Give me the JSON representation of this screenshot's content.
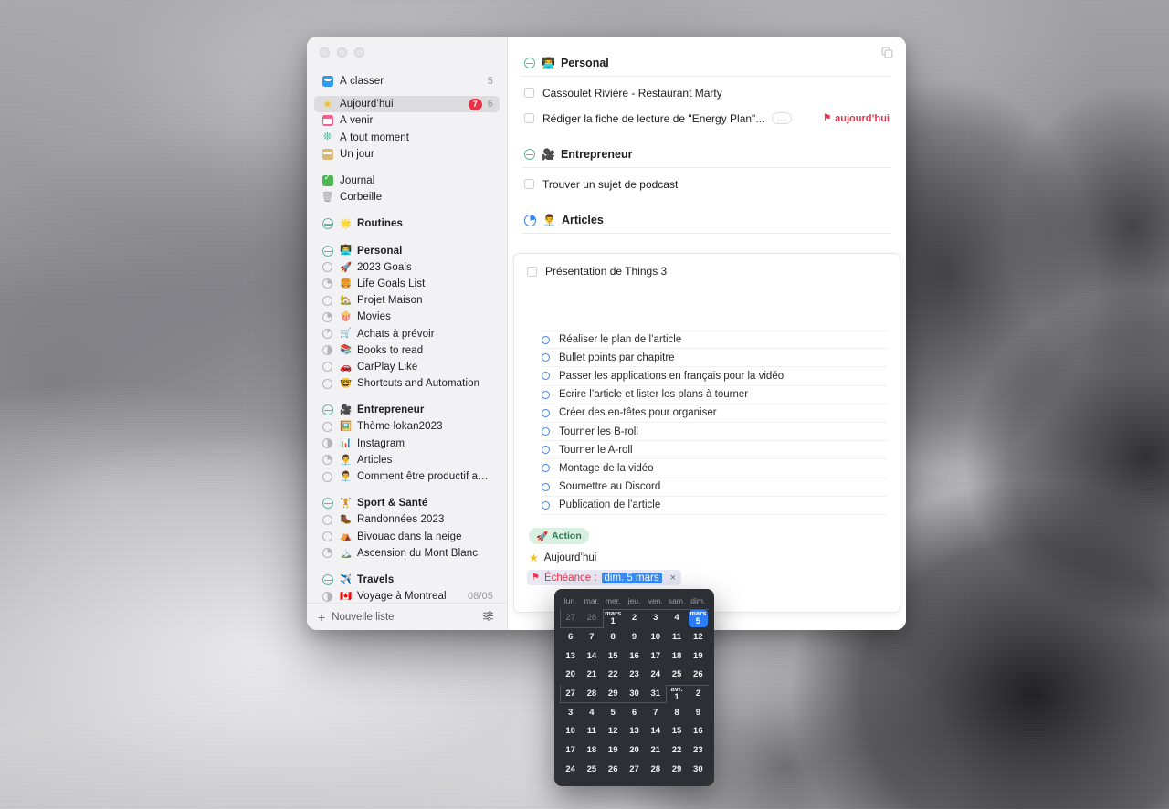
{
  "window": {
    "traffic_lights": [
      "close",
      "minimize",
      "zoom"
    ],
    "duplicate_icon": "duplicate-icon"
  },
  "sidebar": {
    "smart_lists": [
      {
        "icon": "inbox-icon",
        "label": "À classer",
        "count": "5"
      },
      {
        "icon": "star-icon",
        "label": "Aujourd’hui",
        "badge": "7",
        "count": "6",
        "selected": true
      },
      {
        "icon": "calendar-icon",
        "label": "À venir"
      },
      {
        "icon": "layers-icon",
        "label": "À tout moment"
      },
      {
        "icon": "someday-icon",
        "label": "Un jour"
      }
    ],
    "utility_lists": [
      {
        "icon": "journal-icon",
        "label": "Journal"
      },
      {
        "icon": "trash-icon",
        "label": "Corbeille"
      }
    ],
    "areas": [
      {
        "emoji": "🌟",
        "label": "Routines",
        "projects": []
      },
      {
        "emoji": "👨‍💻",
        "label": "Personal",
        "projects": [
          {
            "progress": "p0",
            "emoji": "🚀",
            "label": "2023 Goals"
          },
          {
            "progress": "p25",
            "emoji": "🍔",
            "label": "Life Goals List"
          },
          {
            "progress": "p0",
            "emoji": "🏡",
            "label": "Projet Maison"
          },
          {
            "progress": "p25",
            "emoji": "🍿",
            "label": "Movies"
          },
          {
            "progress": "p12",
            "emoji": "🛒",
            "label": "Achats à prévoir"
          },
          {
            "progress": "p50",
            "emoji": "📚",
            "label": "Books to read"
          },
          {
            "progress": "p0",
            "emoji": "🚗",
            "label": "CarPlay Like"
          },
          {
            "progress": "p0",
            "emoji": "🤓",
            "label": "Shortcuts and Automation"
          }
        ]
      },
      {
        "emoji": "🎥",
        "label": "Entrepreneur",
        "projects": [
          {
            "progress": "p0",
            "emoji": "🖼️",
            "label": "Thème lokan2023"
          },
          {
            "progress": "p50",
            "emoji": "📊",
            "label": "Instagram"
          },
          {
            "progress": "p25",
            "emoji": "👨‍💼",
            "label": "Articles"
          },
          {
            "progress": "p0",
            "emoji": "👨‍💼",
            "label": "Comment être productif avec..."
          }
        ]
      },
      {
        "emoji": "🏋️",
        "label": "Sport & Santé",
        "projects": [
          {
            "progress": "p0",
            "emoji": "🥾",
            "label": "Randonnées 2023"
          },
          {
            "progress": "p0",
            "emoji": "⛺",
            "label": "Bivouac dans la neige"
          },
          {
            "progress": "p25",
            "emoji": "🏔️",
            "label": "Ascension du Mont Blanc"
          }
        ]
      },
      {
        "emoji": "✈️",
        "label": "Travels",
        "projects": [
          {
            "progress": "p50",
            "emoji": "🇨🇦",
            "label": "Voyage à Montreal",
            "date": "08/05"
          }
        ]
      }
    ],
    "footer": {
      "new_list_label": "Nouvelle liste",
      "plus_icon": "plus-icon",
      "settings_icon": "sliders-icon"
    }
  },
  "main": {
    "groups": [
      {
        "icon": "area-icon",
        "emoji": "👨‍💻",
        "title": "Personal",
        "todos": [
          {
            "label": "Cassoulet Rivière - Restaurant Marty"
          },
          {
            "label": "Rédiger la fiche de lecture de \"Energy Plan\"...",
            "notes": "...",
            "due": "aujourd’hui",
            "flag": "deadline-flag-icon"
          }
        ]
      },
      {
        "icon": "area-icon",
        "emoji": "🎥",
        "title": "Entrepreneur",
        "todos": [
          {
            "label": "Trouver un sujet de podcast"
          }
        ]
      },
      {
        "icon": "project-pie-icon",
        "emoji": "👨‍💼",
        "title": "Articles",
        "todos": []
      }
    ],
    "task_card": {
      "title": "Présentation de Things 3",
      "checklist": [
        "Réaliser le plan de l’article",
        "Bullet points par chapitre",
        "Passer les applications en français pour la vidéo",
        "Ecrire l’article et lister les plans à tourner",
        "Créer des en-têtes pour organiser",
        "Tourner les B-roll",
        "Tourner le A-roll",
        "Montage de la vidéo",
        "Soumettre au Discord",
        "Publication de l’article"
      ],
      "tag": {
        "emoji": "🚀",
        "label": "Action"
      },
      "when": {
        "icon": "star-icon",
        "label": "Aujourd’hui"
      },
      "deadline": {
        "flag_icon": "deadline-flag-icon",
        "label": "Échéance :",
        "value": "dim. 5 mars",
        "clear_icon": "×"
      }
    }
  },
  "calendar": {
    "weekday_headers": [
      "lun.",
      "mar.",
      "mer.",
      "jeu.",
      "ven.",
      "sam.",
      "dim."
    ],
    "selected": "mars 5",
    "weeks": [
      [
        {
          "d": "27",
          "dim": true
        },
        {
          "d": "28",
          "dim": true
        },
        {
          "d": "1",
          "month": "mars"
        },
        {
          "d": "2"
        },
        {
          "d": "3"
        },
        {
          "d": "4"
        },
        {
          "d": "5",
          "month": "mars",
          "selected": true
        }
      ],
      [
        {
          "d": "6"
        },
        {
          "d": "7"
        },
        {
          "d": "8"
        },
        {
          "d": "9"
        },
        {
          "d": "10"
        },
        {
          "d": "11"
        },
        {
          "d": "12"
        }
      ],
      [
        {
          "d": "13"
        },
        {
          "d": "14"
        },
        {
          "d": "15"
        },
        {
          "d": "16"
        },
        {
          "d": "17"
        },
        {
          "d": "18"
        },
        {
          "d": "19"
        }
      ],
      [
        {
          "d": "20"
        },
        {
          "d": "21"
        },
        {
          "d": "22"
        },
        {
          "d": "23"
        },
        {
          "d": "24"
        },
        {
          "d": "25"
        },
        {
          "d": "26"
        }
      ],
      [
        {
          "d": "27"
        },
        {
          "d": "28"
        },
        {
          "d": "29"
        },
        {
          "d": "30"
        },
        {
          "d": "31"
        },
        {
          "d": "1",
          "month": "avr."
        },
        {
          "d": "2"
        }
      ],
      [
        {
          "d": "3"
        },
        {
          "d": "4"
        },
        {
          "d": "5"
        },
        {
          "d": "6"
        },
        {
          "d": "7"
        },
        {
          "d": "8"
        },
        {
          "d": "9"
        }
      ],
      [
        {
          "d": "10"
        },
        {
          "d": "11"
        },
        {
          "d": "12"
        },
        {
          "d": "13"
        },
        {
          "d": "14"
        },
        {
          "d": "15"
        },
        {
          "d": "16"
        }
      ],
      [
        {
          "d": "17"
        },
        {
          "d": "18"
        },
        {
          "d": "19"
        },
        {
          "d": "20"
        },
        {
          "d": "21"
        },
        {
          "d": "22"
        },
        {
          "d": "23"
        }
      ],
      [
        {
          "d": "24"
        },
        {
          "d": "25"
        },
        {
          "d": "26"
        },
        {
          "d": "27"
        },
        {
          "d": "28"
        },
        {
          "d": "29"
        },
        {
          "d": "30"
        }
      ]
    ]
  },
  "colors": {
    "accent_blue": "#2a7cf7",
    "badge_red": "#e8334a",
    "tag_green_bg": "#d7f0e2",
    "tag_green_fg": "#2f7a56",
    "sidebar_bg": "#f2f2f4",
    "calendar_bg": "#2c2f33"
  }
}
